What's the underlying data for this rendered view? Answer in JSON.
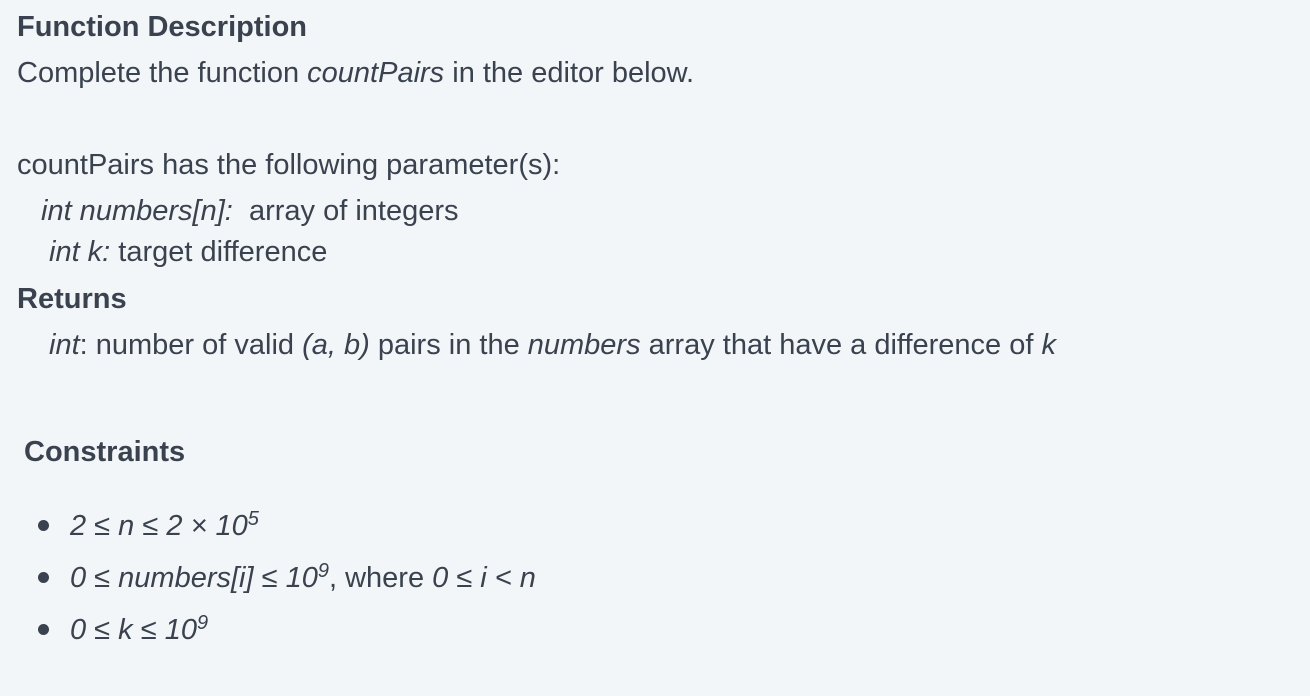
{
  "function_description": {
    "heading": "Function Description",
    "intro_prefix": "Complete the function ",
    "function_name": "countPairs",
    "intro_suffix": " in the editor below."
  },
  "parameters": {
    "intro": "countPairs has the following parameter(s):",
    "items": [
      {
        "name": "int numbers[n]:",
        "description": "  array of integers"
      },
      {
        "name": "int k:",
        "description": " target difference"
      }
    ]
  },
  "returns": {
    "heading": "Returns",
    "type": "int",
    "colon": ":",
    "text_1": " number of valid ",
    "pair": "(a, b)",
    "text_2": " pairs in the ",
    "array_name": "numbers",
    "text_3": " array that have a difference of ",
    "k": "k"
  },
  "constraints": {
    "heading": "Constraints",
    "items": [
      {
        "math": "2 ≤ n ≤ 2 × 10",
        "exp": "5",
        "text": "",
        "math2": ""
      },
      {
        "math": "0 ≤ numbers[i] ≤ 10",
        "exp": "9",
        "text": ", where ",
        "math2": "0 ≤ i < n"
      },
      {
        "math": "0 ≤ k ≤ 10",
        "exp": "9",
        "text": "",
        "math2": ""
      }
    ]
  }
}
